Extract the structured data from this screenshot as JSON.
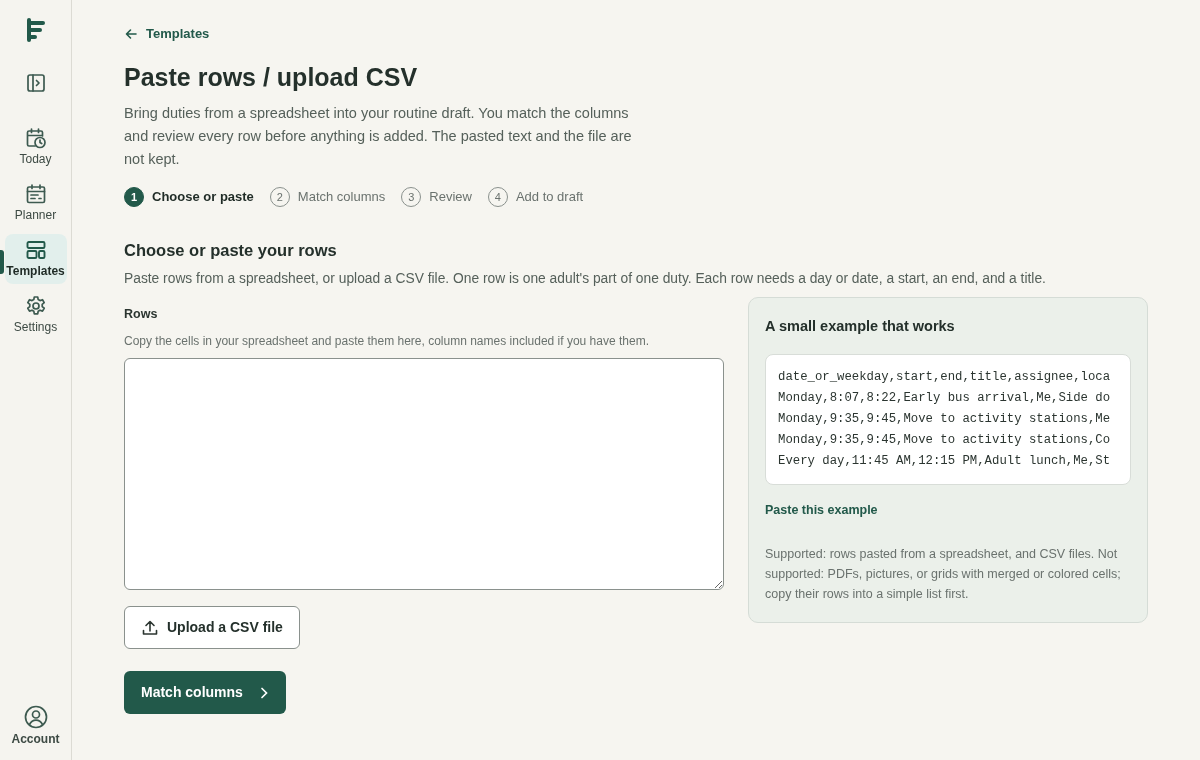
{
  "sidebar": {
    "items": [
      {
        "kind": "collapse",
        "selected": false
      },
      {
        "kind": "today",
        "label": "Today",
        "selected": false
      },
      {
        "kind": "planner",
        "label": "Planner",
        "selected": false
      },
      {
        "kind": "templates",
        "label": "Templates",
        "selected": true
      },
      {
        "kind": "settings",
        "label": "Settings",
        "selected": false
      }
    ],
    "account": {
      "label": "Account"
    }
  },
  "back_link": "Templates",
  "title": "Paste rows / upload CSV",
  "intro": "Bring duties from a spreadsheet into your routine draft. You match the columns and review every row before anything is added. The pasted text and the file are not kept.",
  "steps": [
    {
      "number": "1",
      "label": "Choose or paste",
      "selected": true
    },
    {
      "number": "2",
      "label": "Match columns",
      "selected": false
    },
    {
      "number": "3",
      "label": "Review",
      "selected": false
    },
    {
      "number": "4",
      "label": "Add to draft",
      "selected": false
    }
  ],
  "section": {
    "heading": "Choose or paste your rows",
    "description": "Paste rows from a spreadsheet, or upload a CSV file. One row is one adult's part of one duty. Each row needs a day or date, a start, an end, and a title."
  },
  "rows_field": {
    "label": "Rows",
    "hint": "Copy the cells in your spreadsheet and paste them here, column names included if you have them."
  },
  "upload_button": "Upload a CSV file",
  "next_button": "Match columns",
  "example": {
    "heading": "A small example that works",
    "lines": [
      "date_or_weekday,start,end,title,assignee,loca",
      "Monday,8:07,8:22,Early bus arrival,Me,Side do",
      "Monday,9:35,9:45,Move to activity stations,Me",
      "Monday,9:35,9:45,Move to activity stations,Co",
      "Every day,11:45 AM,12:15 PM,Adult lunch,Me,St"
    ],
    "paste_link": "Paste this example",
    "note": "Supported: rows pasted from a spreadsheet, and CSV files. Not supported: PDFs, pictures, or grids with merged or colored cells; copy their rows into a simple list first."
  }
}
